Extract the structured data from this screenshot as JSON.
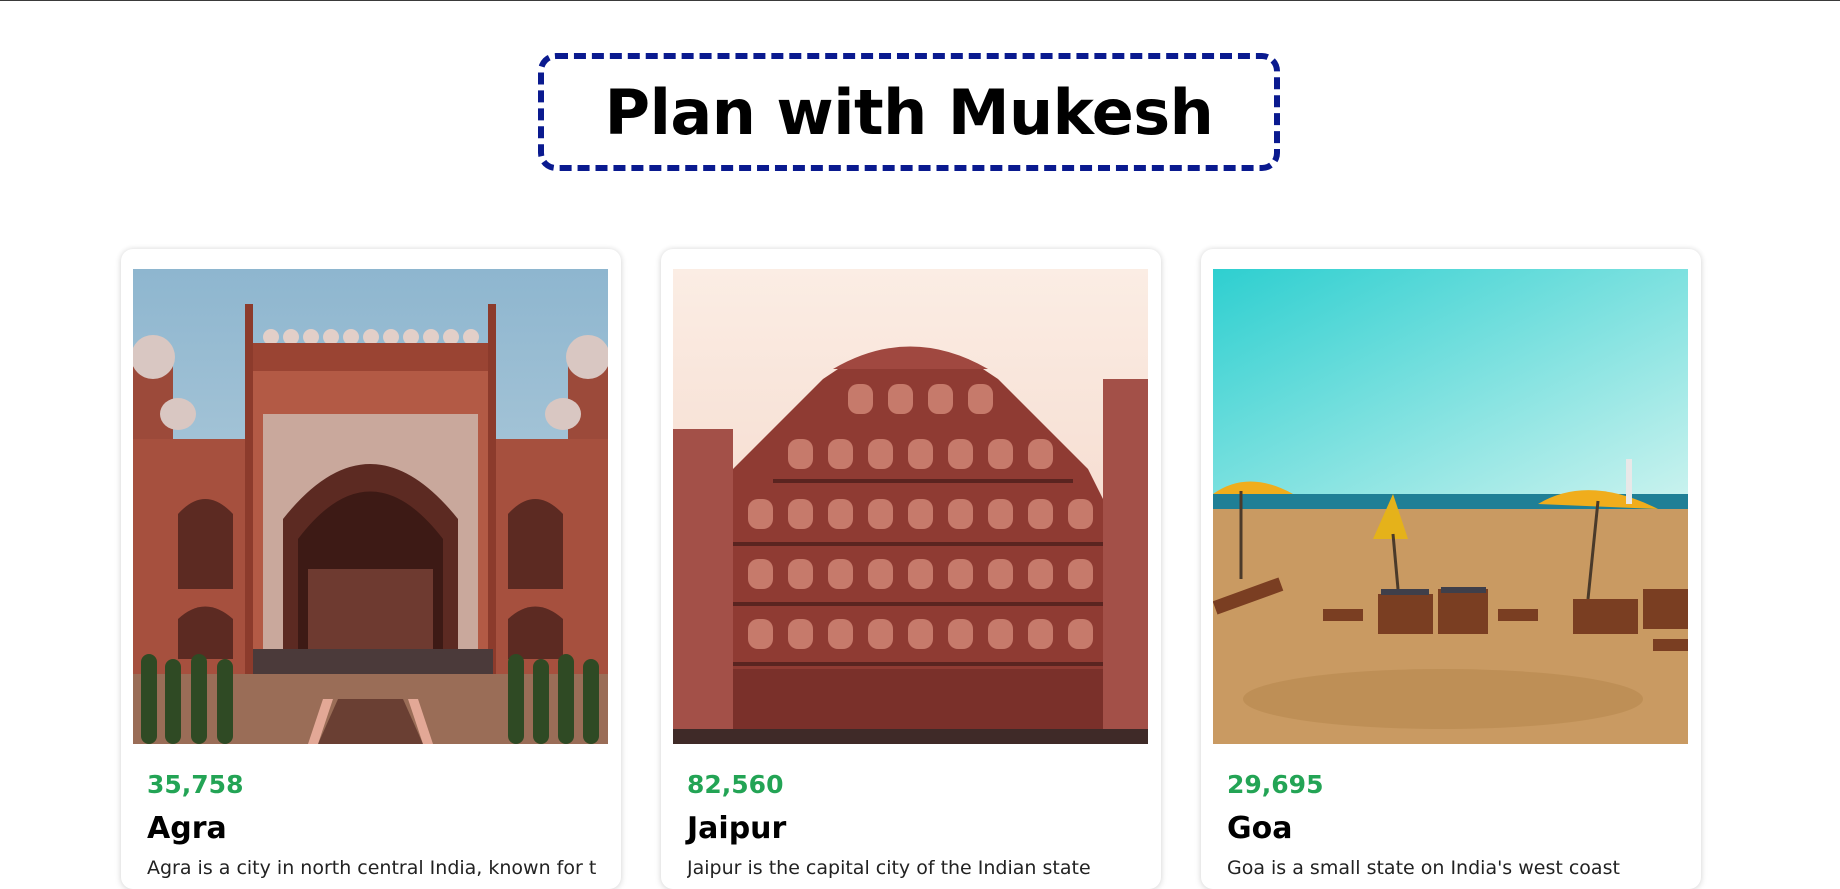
{
  "header": {
    "title": "Plan with Mukesh"
  },
  "colors": {
    "title_border": "#0a1a8f",
    "count_green": "#23a455"
  },
  "cards": [
    {
      "count": "35,758",
      "name": "Agra",
      "description": "Agra is a city in north central India, known for the",
      "image_icon": "agra-gate-image"
    },
    {
      "count": "82,560",
      "name": "Jaipur",
      "description": "Jaipur is the capital city of the Indian state",
      "image_icon": "hawa-mahal-image"
    },
    {
      "count": "29,695",
      "name": "Goa",
      "description": "Goa is a small state on India's west coast",
      "image_icon": "goa-beach-image"
    }
  ]
}
